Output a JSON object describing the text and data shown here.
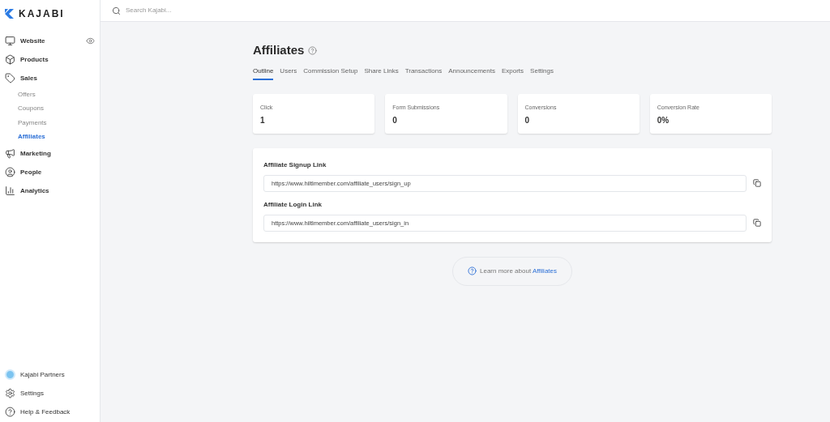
{
  "logo": {
    "text": "KAJABI"
  },
  "search": {
    "placeholder": "Search Kajabi..."
  },
  "sidebar": {
    "items": [
      {
        "label": "Website",
        "kind": "monitor",
        "selected": false
      },
      {
        "label": "Products",
        "kind": "box",
        "selected": false
      },
      {
        "label": "Sales",
        "kind": "tag",
        "selected": false,
        "children": [
          {
            "label": "Offers",
            "selected": false
          },
          {
            "label": "Coupons",
            "selected": false
          },
          {
            "label": "Payments",
            "selected": false
          },
          {
            "label": "Affiliates",
            "selected": true
          }
        ]
      },
      {
        "label": "Marketing",
        "kind": "megaphone",
        "selected": false
      },
      {
        "label": "People",
        "kind": "user",
        "selected": false
      },
      {
        "label": "Analytics",
        "kind": "chart",
        "selected": false
      }
    ],
    "bottom_items": [
      {
        "label": "Kajabi Partners",
        "kind": "partners"
      },
      {
        "label": "Settings",
        "kind": "settings"
      },
      {
        "label": "Help & Feedback",
        "kind": "help"
      }
    ]
  },
  "page": {
    "title": "Affiliates",
    "tabs": [
      {
        "label": "Outline",
        "selected": true
      },
      {
        "label": "Users",
        "selected": false
      },
      {
        "label": "Commission Setup",
        "selected": false
      },
      {
        "label": "Share Links",
        "selected": false
      },
      {
        "label": "Transactions",
        "selected": false
      },
      {
        "label": "Announcements",
        "selected": false
      },
      {
        "label": "Exports",
        "selected": false
      },
      {
        "label": "Settings",
        "selected": false
      }
    ],
    "stats": [
      {
        "label": "Click",
        "value": "1"
      },
      {
        "label": "Form Submissions",
        "value": "0"
      },
      {
        "label": "Conversions",
        "value": "0"
      },
      {
        "label": "Conversion Rate",
        "value": "0%"
      }
    ],
    "links": [
      {
        "label": "Affiliate Signup Link",
        "value": "https://www.hiltlmember.com/affiliate_users/sign_up"
      },
      {
        "label": "Affiliate Login Link",
        "value": "https://www.hiltlmember.com/affiliate_users/sign_in"
      }
    ],
    "learn_more": {
      "text": "Learn more about ",
      "link": "Affiliates"
    }
  }
}
